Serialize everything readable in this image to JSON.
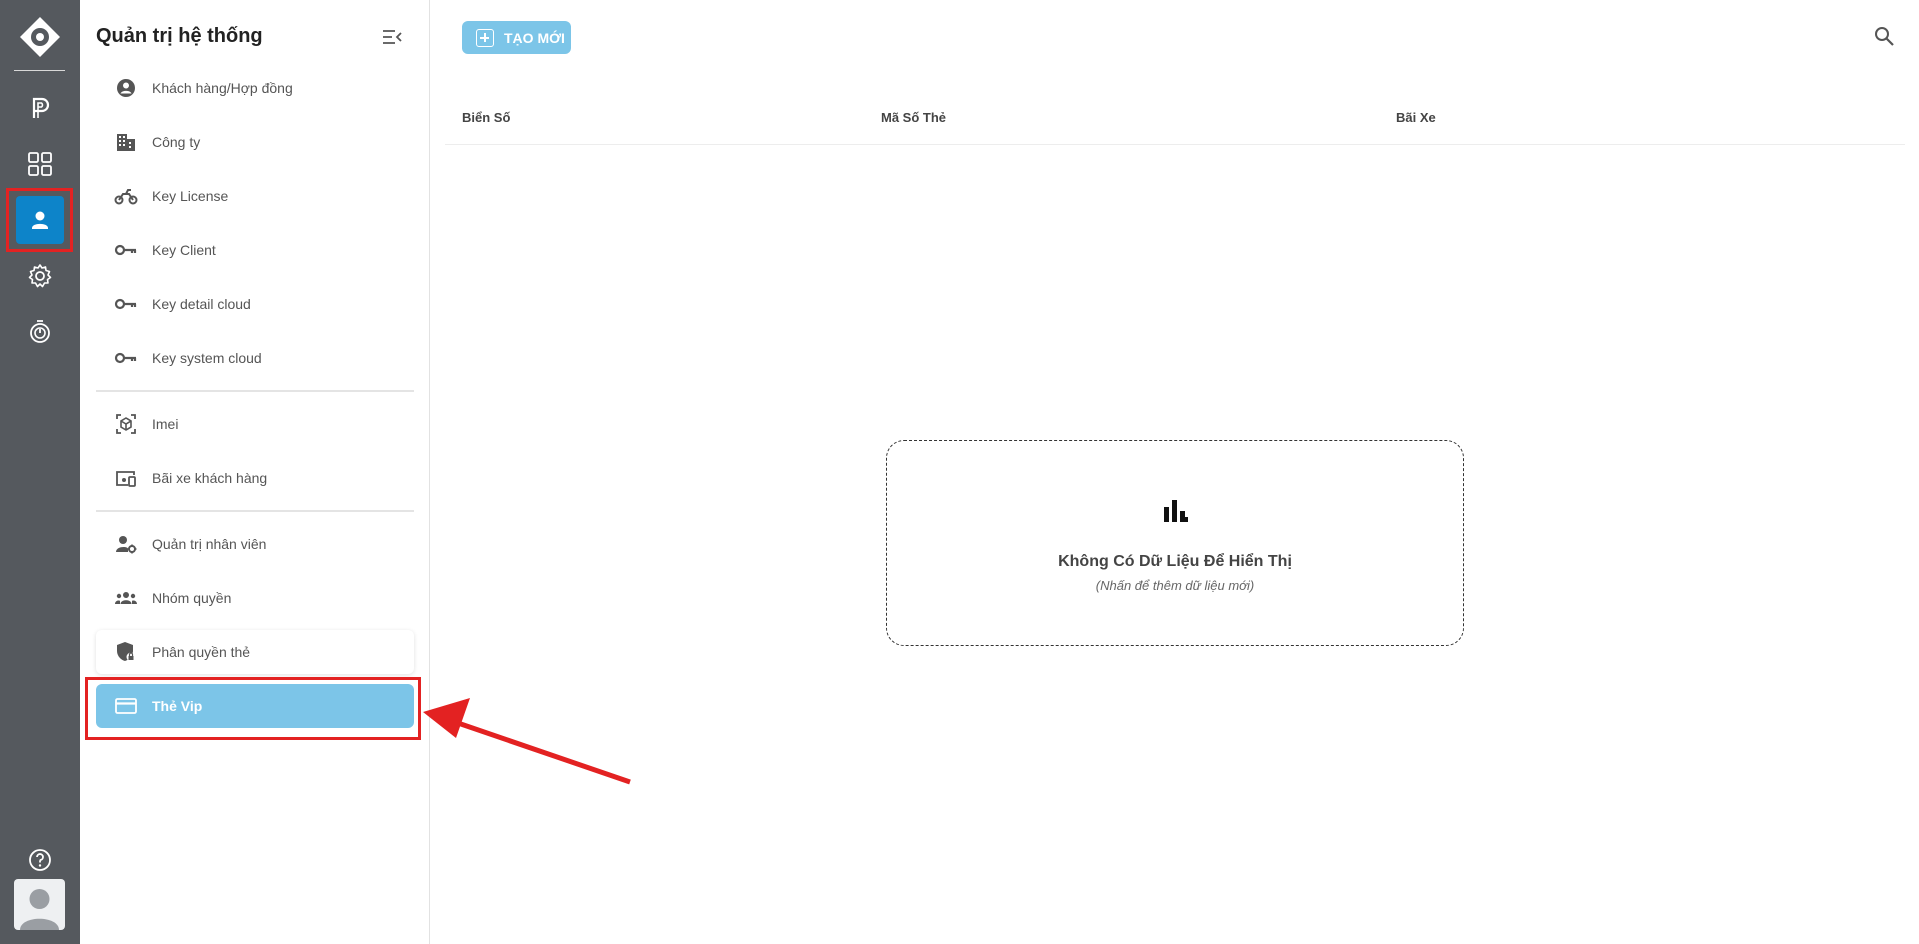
{
  "sidebar": {
    "title": "Quản trị hệ thống",
    "items": [
      {
        "label": "Khách hàng/Hợp đồng",
        "icon": "account-circle-icon"
      },
      {
        "label": "Công ty",
        "icon": "building-icon"
      },
      {
        "label": "Key License",
        "icon": "motorbike-icon"
      },
      {
        "label": "Key Client",
        "icon": "key-icon"
      },
      {
        "label": "Key detail cloud",
        "icon": "key-icon"
      },
      {
        "label": "Key system cloud",
        "icon": "key-icon"
      },
      {
        "label": "Imei",
        "icon": "scan-cube-icon"
      },
      {
        "label": "Bãi xe khách hàng",
        "icon": "devices-icon"
      },
      {
        "label": "Quản trị nhân viên",
        "icon": "user-gear-icon"
      },
      {
        "label": "Nhóm quyền",
        "icon": "group-icon"
      },
      {
        "label": "Phân quyền thẻ",
        "icon": "shield-lock-icon"
      },
      {
        "label": "Thẻ Vip",
        "icon": "credit-card-icon",
        "active": true
      }
    ]
  },
  "rail": {
    "items": [
      "logo-icon",
      "parking-icon",
      "dashboard-grid-icon",
      "user-icon",
      "settings-gear-icon",
      "timer-icon"
    ],
    "active": "user-icon"
  },
  "toolbar": {
    "create_label": "TẠO MỚI"
  },
  "table": {
    "columns": [
      "Biển Số",
      "Mã Số Thẻ",
      "Bãi Xe"
    ]
  },
  "empty_state": {
    "title": "Không Có Dữ Liệu Để Hiển Thị",
    "subtitle": "(Nhấn để thêm dữ liệu mới)"
  },
  "colors": {
    "rail_bg": "#55595e",
    "accent": "#0d84c9",
    "active_item": "#7cc5e8",
    "highlight": "#e32222"
  }
}
